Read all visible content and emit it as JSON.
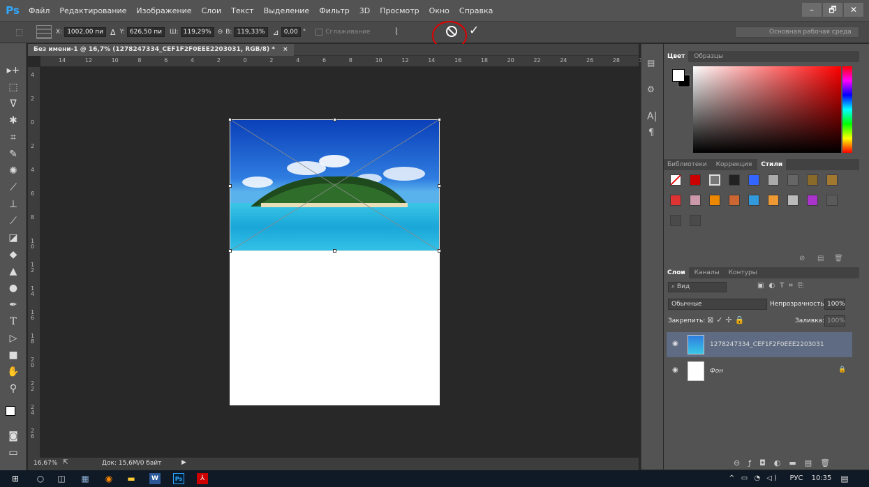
{
  "app": {
    "logo": "Ps"
  },
  "menu": [
    "Файл",
    "Редактирование",
    "Изображение",
    "Слои",
    "Текст",
    "Выделение",
    "Фильтр",
    "3D",
    "Просмотр",
    "Окно",
    "Справка"
  ],
  "window_controls": {
    "minimize": "–",
    "restore": "🗗",
    "close": "✕"
  },
  "options": {
    "x_label": "X:",
    "x_value": "1002,00 пи",
    "y_label": "Y:",
    "y_value": "626,50 пи",
    "w_label": "Ш:",
    "w_value": "119,29%",
    "h_label": "В:",
    "h_value": "119,33%",
    "angle_value": "0,00",
    "angle_unit": "°",
    "interp_label": "Сглаживание",
    "cancel_icon": "⃠",
    "commit_icon": "✓",
    "workspace": "Основная рабочая среда"
  },
  "document": {
    "tab_title": "Без имени-1 @ 16,7% (1278247334_CEF1F2F0EEE2203031, RGB/8) *",
    "close": "×",
    "hruler_ticks": [
      "14",
      "12",
      "10",
      "8",
      "6",
      "4",
      "2",
      "0",
      "2",
      "4",
      "6",
      "8",
      "10",
      "12",
      "14",
      "16",
      "18",
      "20",
      "22",
      "24",
      "26",
      "28",
      "30"
    ],
    "vruler_ticks": [
      "4",
      "2",
      "0",
      "2",
      "4",
      "6",
      "8",
      "1 0",
      "1 2",
      "1 4",
      "1 6",
      "1 8",
      "2 0",
      "2 2",
      "2 4",
      "2 6"
    ],
    "zoom": "16,67%",
    "doc_info": "Док: 15,6M/0 байт"
  },
  "color_panel": {
    "tabs": [
      "Цвет",
      "Образцы"
    ]
  },
  "styles_panel": {
    "tabs": [
      "Библиотеки",
      "Коррекция",
      "Стили"
    ]
  },
  "layers_panel": {
    "tabs": [
      "Слои",
      "Каналы",
      "Контуры"
    ],
    "filter": "Вид",
    "blend_mode": "Обычные",
    "opacity_label": "Непрозрачность:",
    "opacity_value": "100%",
    "lock_label": "Закрепить:",
    "fill_label": "Заливка:",
    "fill_value": "100%",
    "layers": [
      {
        "name": "1278247334_CEF1F2F0EEE2203031",
        "selected": true
      },
      {
        "name": "Фон",
        "selected": false
      }
    ]
  },
  "taskbar": {
    "lang": "РУС",
    "time": "10:35"
  },
  "colors": {
    "accent": "#31a8ff",
    "highlight_ring": "#e00000",
    "selected_layer": "#5e6b82"
  }
}
